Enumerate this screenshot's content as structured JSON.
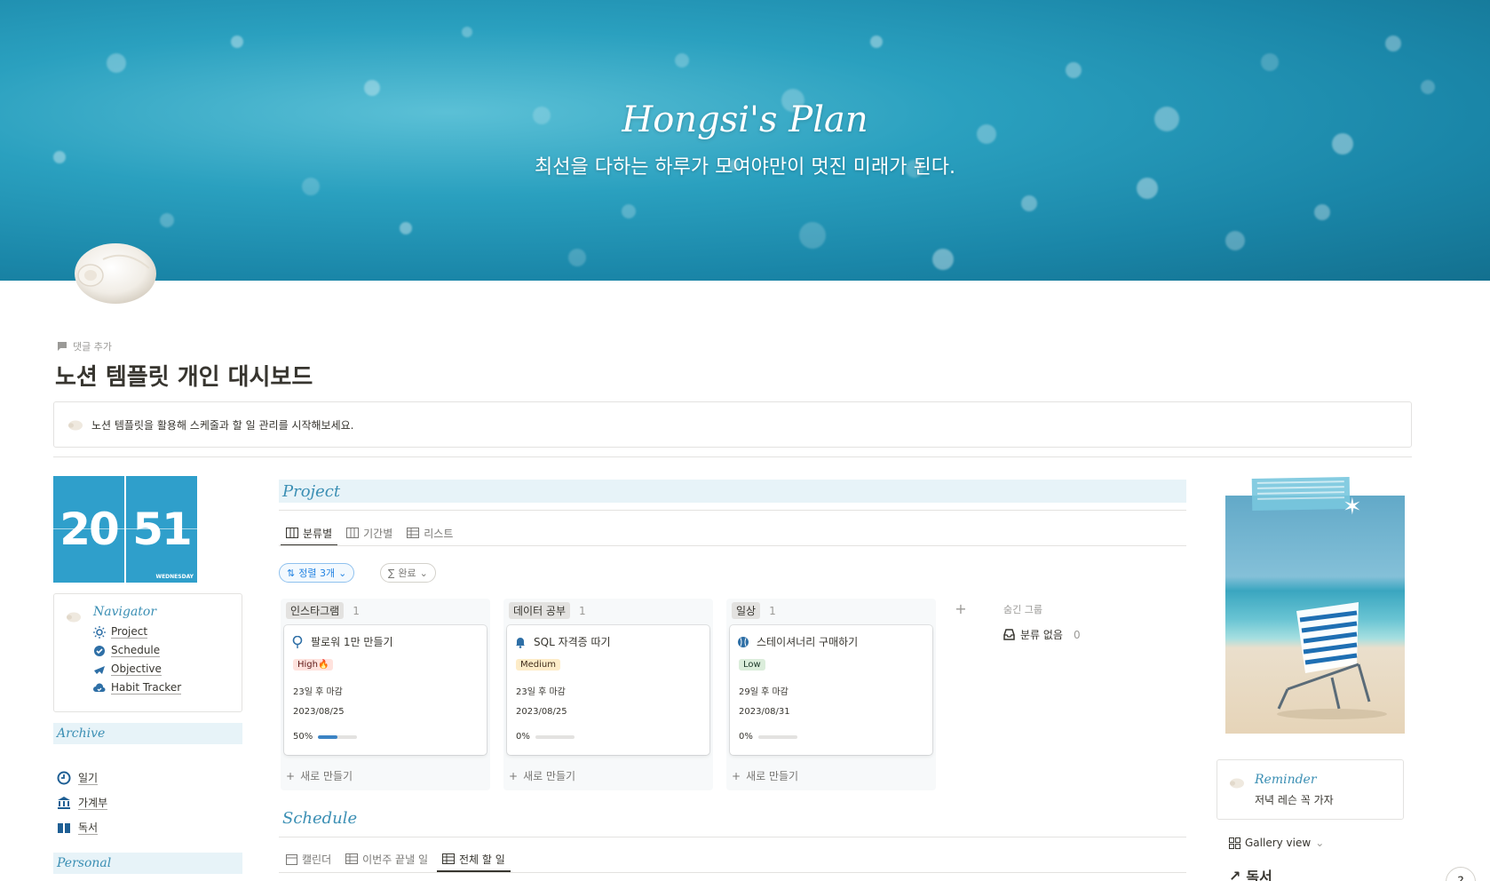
{
  "cover": {
    "title": "Hongsi's Plan",
    "subtitle": "최선을 다하는 하루가 모여야만이 멋진 미래가 된다."
  },
  "header": {
    "add_comment": "댓글 추가",
    "page_title": "노션 템플릿 개인 대시보드",
    "callout_text": "노션 템플릿을 활용해 스케줄과 할 일 관리를 시작해보세요."
  },
  "clock": {
    "hour": "20",
    "minute": "51",
    "day": "WEDNESDAY",
    "color": "#2f9fcb"
  },
  "navigator": {
    "title": "Navigator",
    "items": [
      {
        "label": "Project",
        "icon": "sun-gear-icon"
      },
      {
        "label": "Schedule",
        "icon": "badge-check-icon"
      },
      {
        "label": "Objective",
        "icon": "plane-icon"
      },
      {
        "label": "Habit Tracker",
        "icon": "cloud-check-icon"
      }
    ]
  },
  "archive": {
    "title": "Archive",
    "items": [
      {
        "label": "일기",
        "icon": "clock-icon"
      },
      {
        "label": "가계부",
        "icon": "bank-icon"
      },
      {
        "label": "독서",
        "icon": "book-icon"
      }
    ]
  },
  "personal": {
    "title": "Personal"
  },
  "project": {
    "title": "Project",
    "tabs": [
      "분류별",
      "기간별",
      "리스트"
    ],
    "active_tab": "분류별",
    "sort_label": "정렬 3개",
    "filter_label": "완료",
    "columns": [
      {
        "group": "인스타그램",
        "count": "1",
        "tag_color": "#e3e2e0",
        "card": {
          "title": "팔로워 1만 만들기",
          "icon": "balloon-icon",
          "priority": "High🔥",
          "priority_bg": "#ffe2dd",
          "priority_fg": "#5d1715",
          "due": "23일 후 마감",
          "date": "2023/08/25",
          "progress_label": "50%",
          "progress": 0.5
        }
      },
      {
        "group": "데이터 공부",
        "count": "1",
        "tag_color": "#e3e2e0",
        "card": {
          "title": "SQL 자격증 따기",
          "icon": "bell-icon",
          "priority": "Medium",
          "priority_bg": "#fdecc8",
          "priority_fg": "#402c1b",
          "due": "23일 후 마감",
          "date": "2023/08/25",
          "progress_label": "0%",
          "progress": 0
        }
      },
      {
        "group": "일상",
        "count": "1",
        "tag_color": "#e3e2e0",
        "card": {
          "title": "스테이셔너리 구매하기",
          "icon": "baseball-icon",
          "priority": "Low",
          "priority_bg": "#dbeddb",
          "priority_fg": "#1c3829",
          "due": "29일 후 마감",
          "date": "2023/08/31",
          "progress_label": "0%",
          "progress": 0
        }
      }
    ],
    "new_label": "새로 만들기",
    "hidden_groups": "숨긴 그룹",
    "no_group_label": "분류 없음",
    "no_group_count": "0"
  },
  "schedule": {
    "title": "Schedule",
    "tabs": [
      "캘린더",
      "이번주 끝낼 일",
      "전체 할 일"
    ],
    "active_tab": "전체 할 일"
  },
  "reminder": {
    "title": "Reminder",
    "text": "저녁 레슨 꼭 가자"
  },
  "gallery": {
    "label": "Gallery view"
  },
  "reading": {
    "title": "독서"
  },
  "help": {
    "label": "?"
  },
  "colors": {
    "accent": "#3b8fb4",
    "section_bg": "#e7f3f8",
    "clock_bg": "#2f9fcb"
  }
}
